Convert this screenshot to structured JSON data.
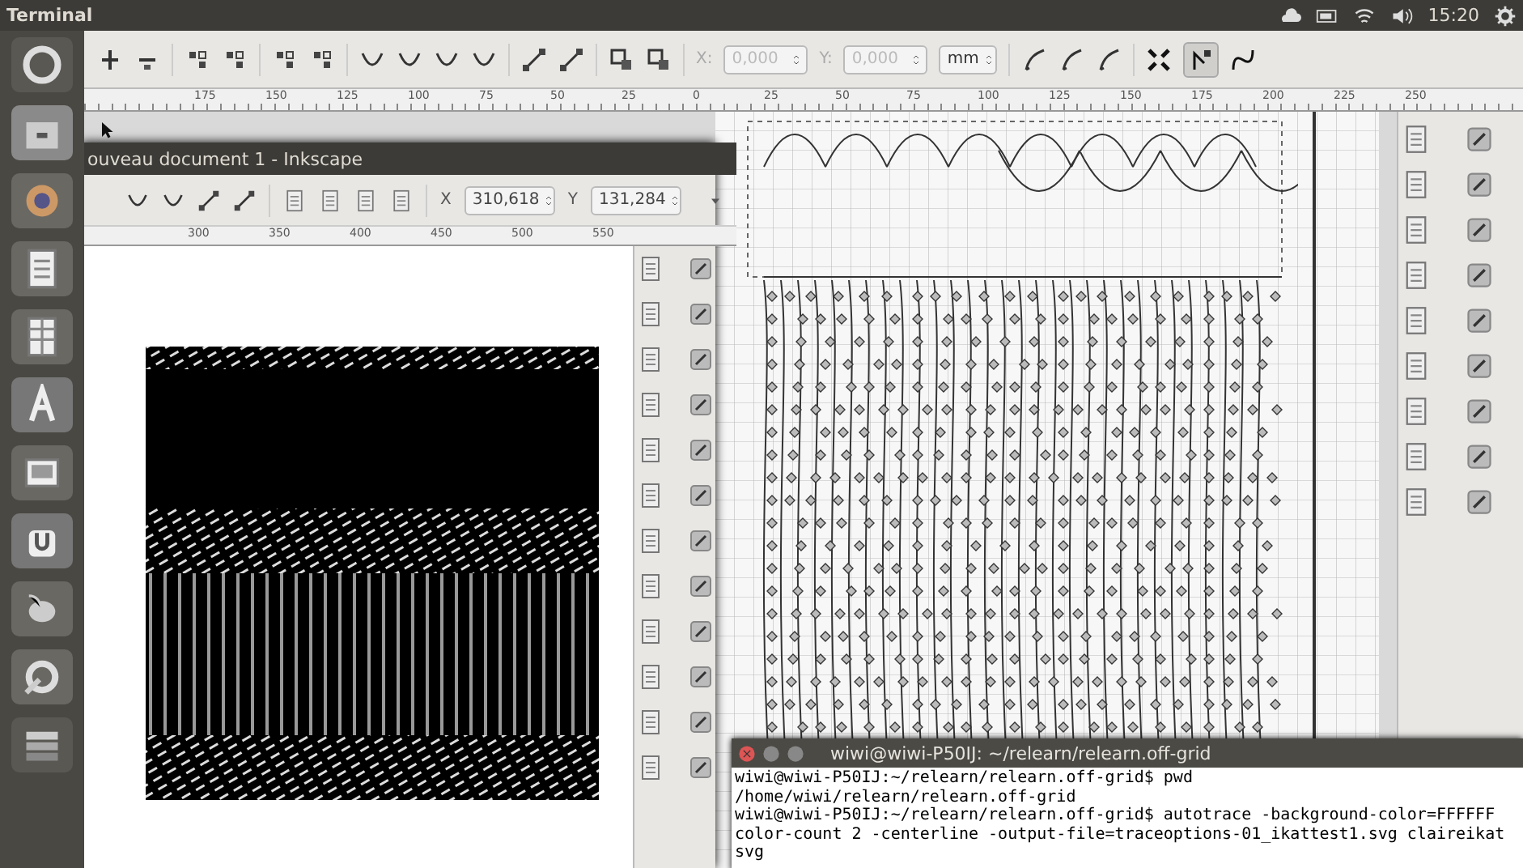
{
  "top_bar": {
    "title": "Terminal",
    "time": "15:20"
  },
  "toolbar": {
    "x_label": "X:",
    "x_value": "0,000",
    "y_label": "Y:",
    "y_value": "0,000",
    "unit": "mm"
  },
  "ruler": {
    "labels": [
      "175",
      "150",
      "125",
      "100",
      "75",
      "50",
      "25",
      "0",
      "25",
      "50",
      "75",
      "100",
      "125",
      "150",
      "175",
      "200",
      "225",
      "250"
    ]
  },
  "inkscape_window": {
    "title": "ouveau document 1 - Inkscape",
    "x_label": "X",
    "x_value": "310,618",
    "y_label": "Y",
    "y_value": "131,284",
    "ruler_labels": [
      "300",
      "350",
      "400",
      "450",
      "500",
      "550"
    ]
  },
  "terminal": {
    "title": "wiwi@wiwi-P50IJ: ~/relearn/relearn.off-grid",
    "lines": [
      "wiwi@wiwi-P50IJ:~/relearn/relearn.off-grid$ pwd",
      "/home/wiwi/relearn/relearn.off-grid",
      "wiwi@wiwi-P50IJ:~/relearn/relearn.off-grid$ autotrace -background-color=FFFFFF",
      "color-count 2 -centerline -output-file=traceoptions-01_ikattest1.svg claireikat",
      "svg"
    ]
  }
}
